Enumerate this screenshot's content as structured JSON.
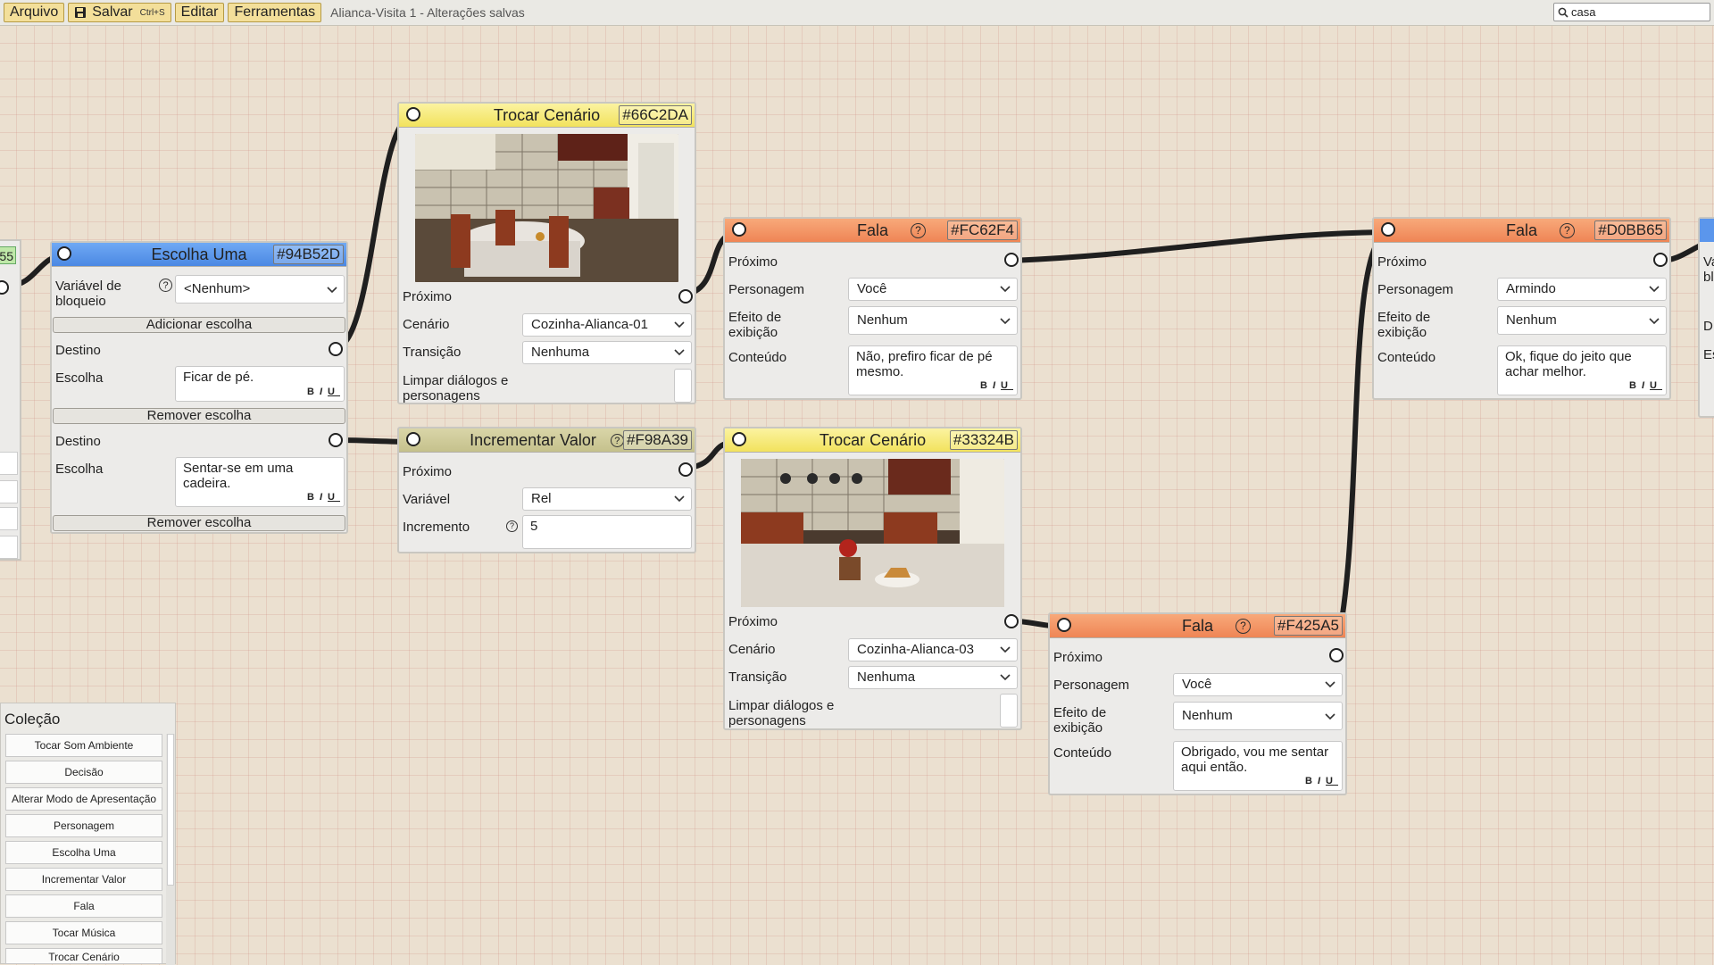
{
  "toolbar": {
    "menu_file": "Arquivo",
    "save_label": "Salvar",
    "save_shortcut": "Ctrl+S",
    "menu_edit": "Editar",
    "menu_tools": "Ferramentas",
    "doc_title": "Alianca-Visita 1 - Alterações salvas",
    "search_value": "casa"
  },
  "nodes": {
    "escolha": {
      "title": "Escolha Uma",
      "id": "#94B52D",
      "color": "#5b96ec",
      "lock_var_label": "Variável de bloqueio",
      "lock_var_value": "<Nenhum>",
      "add_choice": "Adicionar escolha",
      "dest_label": "Destino",
      "choice_label": "Escolha",
      "choice1": "Ficar de pé.",
      "choice2": "Sentar-se em uma cadeira.",
      "remove_choice": "Remover escolha"
    },
    "trocar1": {
      "title": "Trocar Cenário",
      "id": "#66C2DA",
      "color": "#f5e87a",
      "next_label": "Próximo",
      "scene_label": "Cenário",
      "scene_value": "Cozinha-Alianca-01",
      "transition_label": "Transição",
      "transition_value": "Nenhuma",
      "clear_label": "Limpar diálogos e personagens"
    },
    "incrementar": {
      "title": "Incrementar Valor",
      "id": "#F98A39",
      "color": "#ccc896",
      "next_label": "Próximo",
      "var_label": "Variável",
      "var_value": "Rel",
      "inc_label": "Incremento",
      "inc_value": "5"
    },
    "fala1": {
      "title": "Fala",
      "id": "#FC62F4",
      "color": "#f39364",
      "next_label": "Próximo",
      "char_label": "Personagem",
      "char_value": "Você",
      "effect_label": "Efeito de exibição",
      "effect_value": "Nenhum",
      "content_label": "Conteúdo",
      "content_value": "Não, prefiro ficar de pé mesmo."
    },
    "trocar2": {
      "title": "Trocar Cenário",
      "id": "#33324B",
      "color": "#f5e87a",
      "next_label": "Próximo",
      "scene_label": "Cenário",
      "scene_value": "Cozinha-Alianca-03",
      "transition_label": "Transição",
      "transition_value": "Nenhuma",
      "clear_label": "Limpar diálogos e personagens"
    },
    "fala2": {
      "title": "Fala",
      "id": "#F425A5",
      "color": "#f39364",
      "next_label": "Próximo",
      "char_label": "Personagem",
      "char_value": "Você",
      "effect_label": "Efeito de exibição",
      "effect_value": "Nenhum",
      "content_label": "Conteúdo",
      "content_value": " Obrigado, vou me sentar aqui então."
    },
    "fala3": {
      "title": "Fala",
      "id": "#D0BB65",
      "color": "#f39364",
      "next_label": "Próximo",
      "char_label": "Personagem",
      "char_value": "Armindo",
      "effect_label": "Efeito de exibição",
      "effect_value": "Nenhum",
      "content_label": "Conteúdo",
      "content_value": " Ok, fique do jeito que achar melhor."
    }
  },
  "edge_stubs": {
    "left_id_fragment": "55",
    "right_label_a": "Va bl",
    "right_label_b": "D",
    "right_label_c": "Es"
  },
  "collection": {
    "title": "Coleção",
    "items": [
      "Tocar Som Ambiente",
      "Decisão",
      "Alterar Modo de Apresentação",
      "Personagem",
      "Escolha Uma",
      "Incrementar Valor",
      "Fala",
      "Tocar Música",
      "Trocar Cenário"
    ]
  }
}
